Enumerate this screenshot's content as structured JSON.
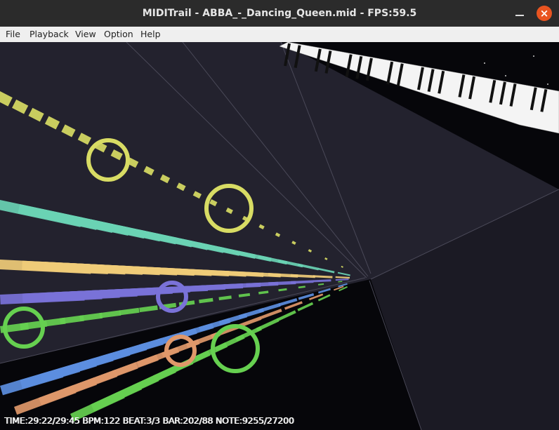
{
  "window": {
    "title": "MIDITrail - ABBA_-_Dancing_Queen.mid - FPS:59.5",
    "close_glyph": "×"
  },
  "menu": {
    "items": [
      {
        "label": "File"
      },
      {
        "label": "Playback"
      },
      {
        "label": "View"
      },
      {
        "label": "Option"
      },
      {
        "label": "Help"
      }
    ]
  },
  "scene": {
    "status_text": "TIME:29:22/29:45 BPM:122 BEAT:3/3 BAR:202/88 NOTE:9255/27200",
    "colors": {
      "yellow": "#d8dc64",
      "teal": "#6ad2b4",
      "gold": "#f0cc78",
      "purple": "#7a72d8",
      "green": "#66d050",
      "blue": "#5c8ee0",
      "orange": "#e0986a",
      "board": "#23222e"
    },
    "icons": [
      "keyboard-icon",
      "ripple-icon"
    ]
  }
}
